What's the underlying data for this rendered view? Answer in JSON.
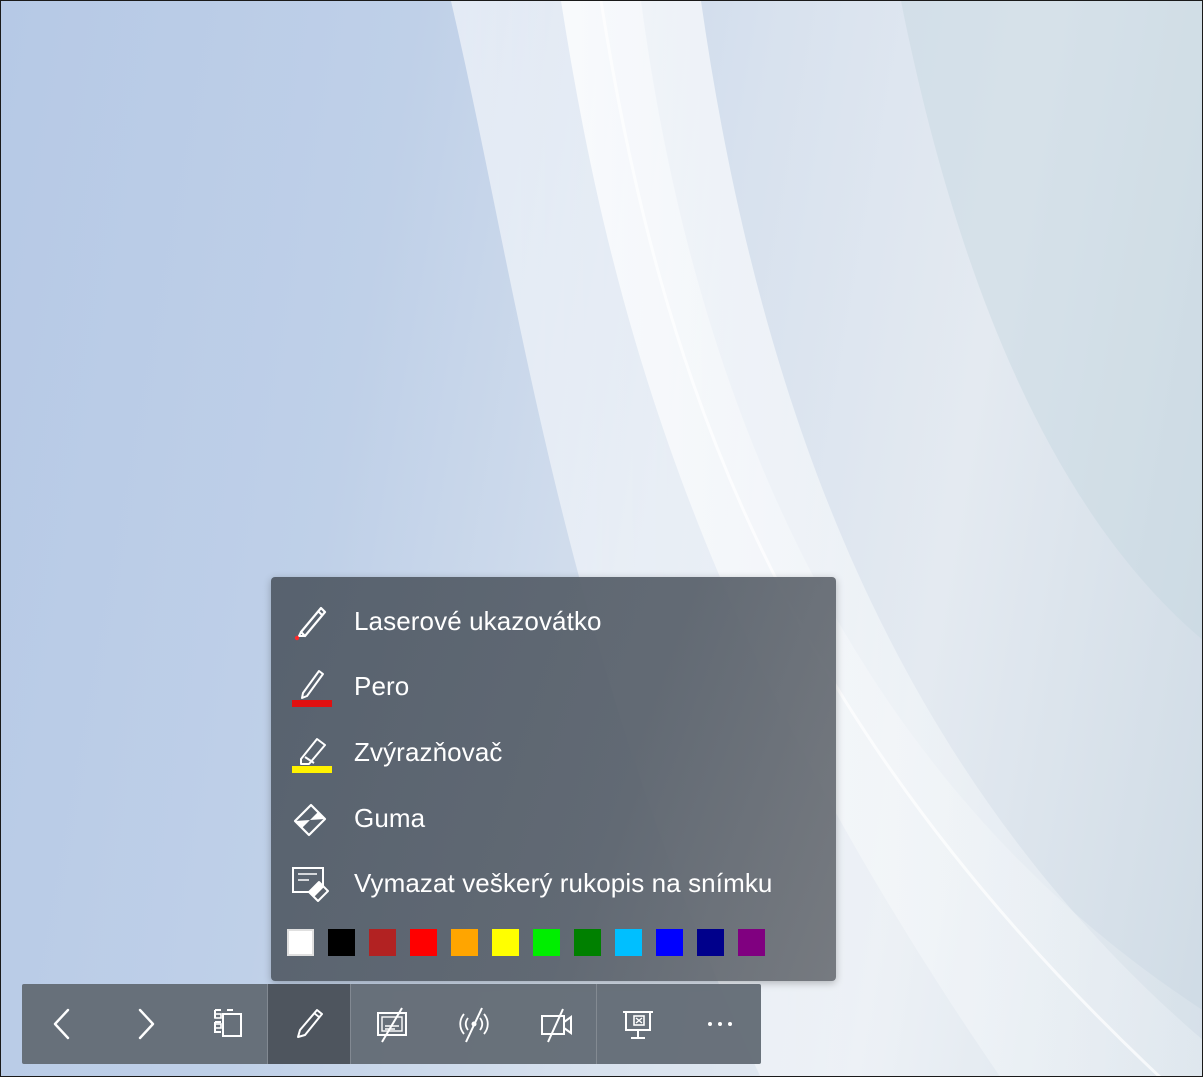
{
  "ink_menu": {
    "items": [
      {
        "label": "Laserové ukazovátko",
        "icon": "laser-pointer-icon",
        "accent": "#ff2a2a"
      },
      {
        "label": "Pero",
        "icon": "pen-icon",
        "accent": "#e01010"
      },
      {
        "label": "Zvýrazňovač",
        "icon": "highlighter-icon",
        "accent": "#fff200"
      },
      {
        "label": "Guma",
        "icon": "eraser-icon"
      },
      {
        "label": "Vymazat veškerý rukopis na snímku",
        "icon": "erase-all-ink-icon"
      }
    ],
    "colors": [
      "#ffffff",
      "#000000",
      "#b22222",
      "#ff0000",
      "#ffa500",
      "#ffff00",
      "#00ee00",
      "#008000",
      "#00bfff",
      "#0000ff",
      "#00008b",
      "#800080"
    ],
    "selected_color": "#ffffff"
  },
  "toolbar": {
    "buttons": [
      {
        "icon": "chevron-left-icon",
        "name": "previous-slide-button"
      },
      {
        "icon": "chevron-right-icon",
        "name": "next-slide-button"
      },
      {
        "icon": "all-slides-icon",
        "name": "see-all-slides-button"
      },
      {
        "icon": "pen-icon",
        "name": "ink-tools-button",
        "active": true
      },
      {
        "icon": "subtitles-off-icon",
        "name": "subtitles-button"
      },
      {
        "icon": "live-broadcast-off-icon",
        "name": "broadcast-button"
      },
      {
        "icon": "camera-off-icon",
        "name": "camera-button"
      },
      {
        "icon": "end-show-icon",
        "name": "end-slideshow-button"
      },
      {
        "icon": "more-options-icon",
        "name": "more-options-button"
      }
    ]
  }
}
